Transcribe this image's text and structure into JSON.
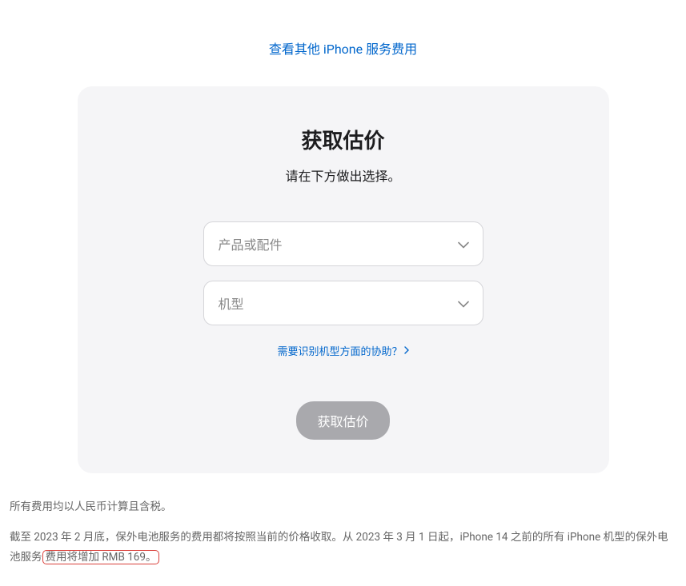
{
  "topLink": "查看其他 iPhone 服务费用",
  "card": {
    "title": "获取估价",
    "subtitle": "请在下方做出选择。",
    "select1Placeholder": "产品或配件",
    "select2Placeholder": "机型",
    "helpLink": "需要识别机型方面的协助？",
    "submit": "获取估价"
  },
  "footer": {
    "note1": "所有费用均以人民币计算且含税。",
    "note2_prefix": "截至 2023 年 2 月底，保外电池服务的费用都将按照当前的价格收取。从 2023 年 3 月 1 日起，iPhone 14 之前的所有 iPhone 机型的保外电池服务",
    "note2_highlight": "费用将增加 RMB 169。"
  }
}
